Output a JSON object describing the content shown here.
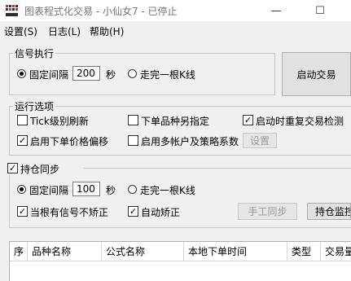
{
  "window": {
    "title": "图表程式化交易 - 小仙女7 - 已停止",
    "minimize_glyph": "—",
    "maximize_glyph": "☐"
  },
  "menu": {
    "items": [
      {
        "label": "设置(S)"
      },
      {
        "label": "日志(L)"
      },
      {
        "label": "帮助(H)"
      }
    ]
  },
  "signal_exec": {
    "title": "信号执行",
    "fixed_interval_label": "固定间隔",
    "interval_value": "200",
    "interval_unit": "秒",
    "finish_kline_label": "走完一根K线",
    "selected": "fixed_interval",
    "start_button": "启动交易"
  },
  "run_options": {
    "title": "运行选项",
    "tick_refresh": {
      "label": "Tick级别刷新",
      "checked": false
    },
    "other_contract": {
      "label": "下单品种另指定",
      "checked": false
    },
    "restart_check": {
      "label": "启动时重复交易检测",
      "checked": true
    },
    "price_offset": {
      "label": "启用下单价格偏移",
      "checked": true
    },
    "multi_account": {
      "label": "启用多帐户及策略系数",
      "checked": false
    },
    "settings_button": "设置"
  },
  "position_sync": {
    "title": "持仓同步",
    "enabled": true,
    "fixed_interval_label": "固定间隔",
    "interval_value": "100",
    "interval_unit": "秒",
    "finish_kline_label": "走完一根K线",
    "selected": "fixed_interval",
    "no_correct_when_signal": {
      "label": "当根有信号不矫正",
      "checked": true
    },
    "auto_correct": {
      "label": "自动矫正",
      "checked": true
    },
    "manual_sync_button": "手工同步",
    "position_monitor_button": "持仓监控"
  },
  "table": {
    "columns": [
      "序",
      "品种名称",
      "公式名称",
      "本地下单时间",
      "类型",
      "交易量"
    ]
  },
  "colors": {
    "accent_red": "#c0392b",
    "window_bg": "#f0f0f0"
  }
}
